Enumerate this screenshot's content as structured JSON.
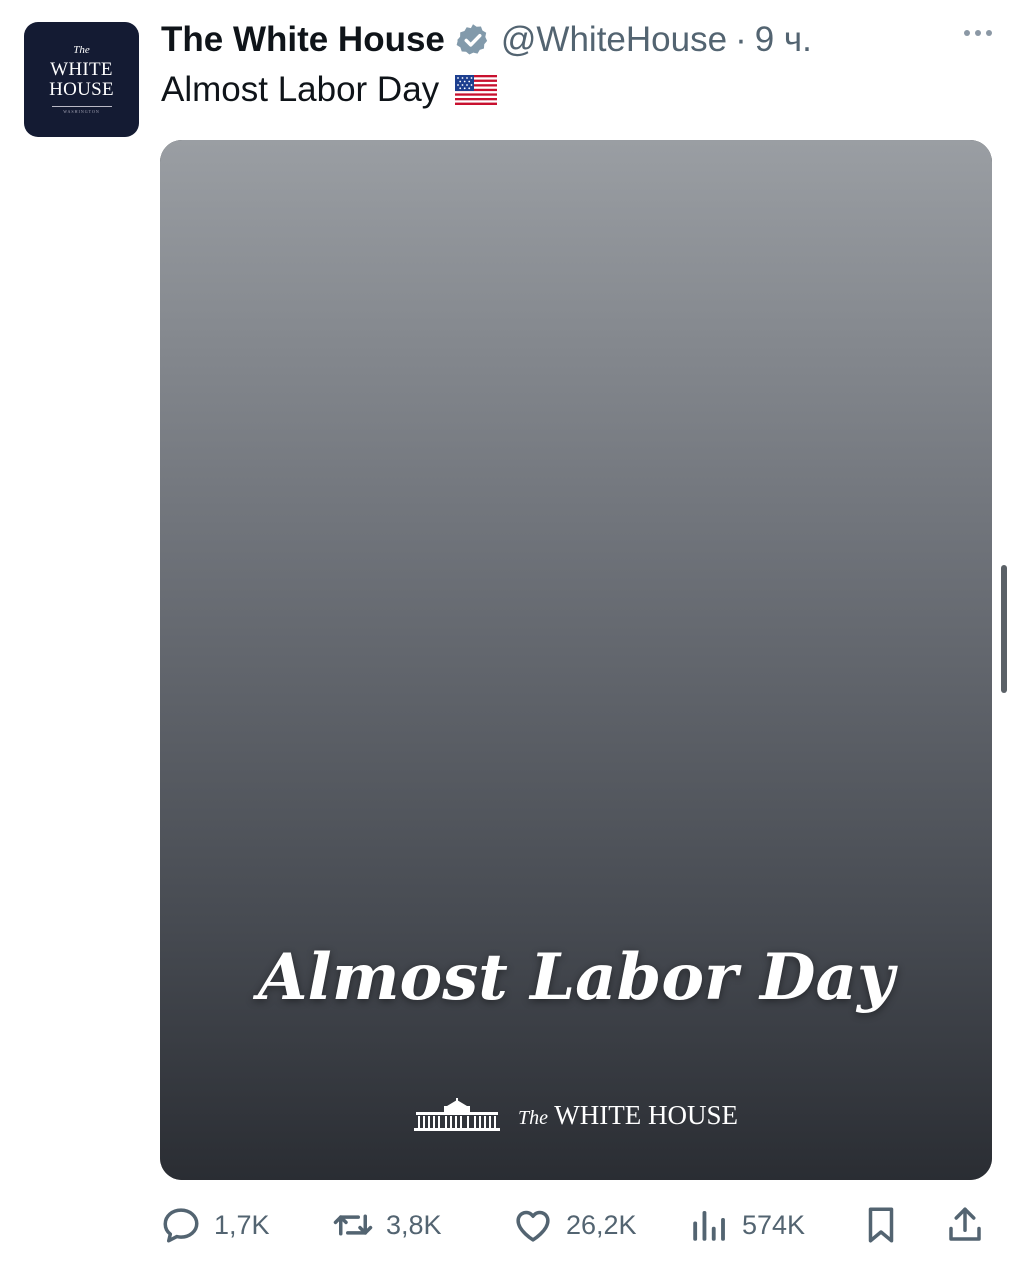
{
  "avatar": {
    "line1": "The",
    "line2": "WHITE",
    "line3": "HOUSE",
    "line4": "WASHINGTON"
  },
  "tweet": {
    "author_name": "The White House",
    "handle": "@WhiteHouse",
    "separator": "·",
    "time": "9 ч.",
    "text": "Almost Labor Day"
  },
  "media": {
    "caption": "Almost Labor Day",
    "logo_the": "The",
    "logo_text": "WHITE HOUSE"
  },
  "actions": {
    "replies": "1,7K",
    "retweets": "3,8K",
    "likes": "26,2K",
    "views": "574K"
  },
  "icons": [
    "verified-badge-icon",
    "more-icon",
    "us-flag-icon",
    "reply-icon",
    "retweet-icon",
    "like-icon",
    "views-icon",
    "bookmark-icon",
    "share-icon"
  ],
  "colors": {
    "verified": "#829aab",
    "avatar_bg": "#141b33",
    "muted": "#536471",
    "text": "#0f1419"
  }
}
